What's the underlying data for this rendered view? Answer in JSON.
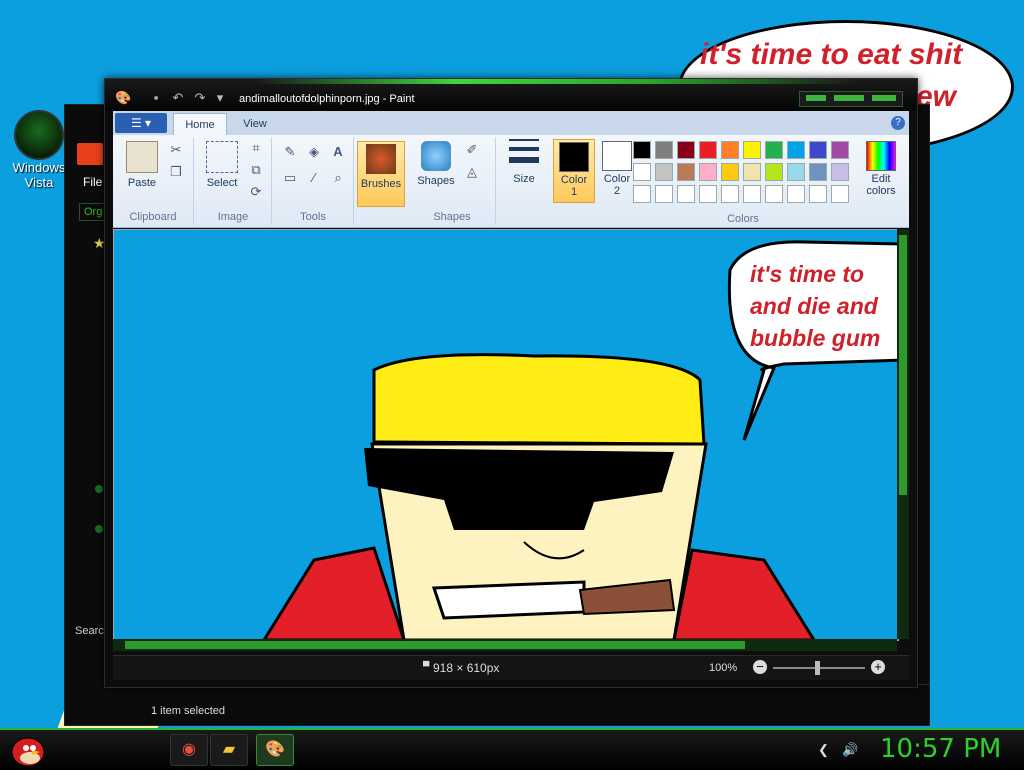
{
  "desktop": {
    "icon_label_1": "Windows",
    "icon_label_2": "Vista",
    "wallpaper_speech": [
      "it's time to eat shit",
      "ew"
    ]
  },
  "explorer": {
    "menu_file": "File",
    "organize_partial": "Org",
    "search_partial": "Searc",
    "status": "1 item selected"
  },
  "paint": {
    "title": "andimalloutofdolphinporn.jpg - Paint",
    "tabs": {
      "home": "Home",
      "view": "View"
    },
    "help": "?",
    "groups": {
      "clipboard": "Clipboard",
      "image": "Image",
      "tools": "Tools",
      "shapes": "Shapes",
      "colors": "Colors"
    },
    "buttons": {
      "paste": "Paste",
      "select": "Select",
      "brushes": "Brushes",
      "shapes": "Shapes",
      "size": "Size",
      "color1_a": "Color",
      "color1_b": "1",
      "color2_a": "Color",
      "color2_b": "2",
      "edit_colors_a": "Edit",
      "edit_colors_b": "colors",
      "text_tool": "A"
    },
    "colors": {
      "color1": "#000000",
      "color2": "#ffffff",
      "palette": [
        "#000000",
        "#7f7f7f",
        "#880015",
        "#ed1c24",
        "#ff7f27",
        "#fff200",
        "#22b14c",
        "#00a2e8",
        "#3f48cc",
        "#a349a4",
        "#ffffff",
        "#c3c3c3",
        "#b97a57",
        "#ffaec9",
        "#ffc90e",
        "#efe4b0",
        "#b5e61d",
        "#99d9ea",
        "#7092be",
        "#c8bfe7"
      ]
    },
    "canvas_speech": [
      "it's time to",
      "and die and",
      "bubble gum"
    ],
    "status_size": "918 × 610px",
    "zoom": "100%",
    "zoom_minus": "−",
    "zoom_plus": "+"
  },
  "taskbar": {
    "clock": "10:57 PM"
  }
}
